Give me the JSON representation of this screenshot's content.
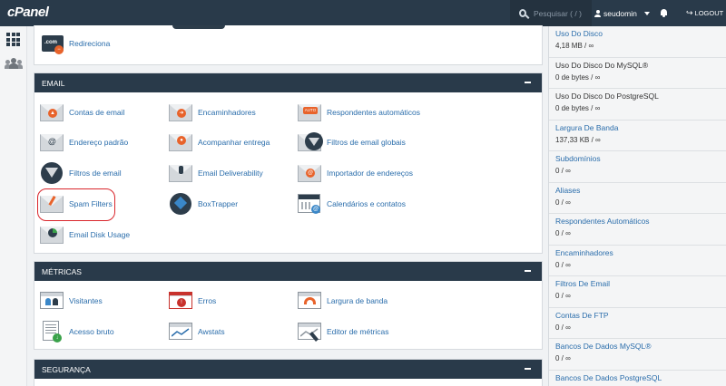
{
  "header": {
    "logo": "cPanel",
    "search_placeholder": "Pesquisar ( / )",
    "username": "seudomin",
    "logout_label": "LOGOUT"
  },
  "top_panel": {
    "items": [
      {
        "label": "Redireciona",
        "icon": "domain-redirect-icon"
      }
    ]
  },
  "email": {
    "title": "EMAIL",
    "items": [
      {
        "label": "Contas de email",
        "icon": "email-accounts-icon"
      },
      {
        "label": "Encaminhadores",
        "icon": "forwarders-icon"
      },
      {
        "label": "Respondentes automáticos",
        "icon": "autoresponders-icon"
      },
      {
        "label": "Endereço padrão",
        "icon": "default-address-icon"
      },
      {
        "label": "Acompanhar entrega",
        "icon": "track-delivery-icon"
      },
      {
        "label": "Filtros de email globais",
        "icon": "global-filters-icon"
      },
      {
        "label": "Filtros de email",
        "icon": "email-filters-icon"
      },
      {
        "label": "Email Deliverability",
        "icon": "deliverability-icon"
      },
      {
        "label": "Importador de endereços",
        "icon": "address-importer-icon"
      },
      {
        "label": "Spam Filters",
        "icon": "spam-filters-icon"
      },
      {
        "label": "BoxTrapper",
        "icon": "boxtrapper-icon"
      },
      {
        "label": "Calendários e contatos",
        "icon": "calendars-icon"
      },
      {
        "label": "Email Disk Usage",
        "icon": "email-disk-usage-icon"
      }
    ]
  },
  "metrics": {
    "title": "MÉTRICAS",
    "items": [
      {
        "label": "Visitantes",
        "icon": "visitors-icon"
      },
      {
        "label": "Erros",
        "icon": "errors-icon"
      },
      {
        "label": "Largura de banda",
        "icon": "bandwidth-icon"
      },
      {
        "label": "Acesso bruto",
        "icon": "raw-access-icon"
      },
      {
        "label": "Awstats",
        "icon": "awstats-icon"
      },
      {
        "label": "Editor de métricas",
        "icon": "metrics-editor-icon"
      }
    ]
  },
  "security": {
    "title": "SEGURANÇA"
  },
  "stats": [
    {
      "label": "Uso Do Disco",
      "value": "4,18 MB / ∞",
      "link": true
    },
    {
      "label": "Uso Do Disco Do MySQL®",
      "value": "0 de bytes / ∞",
      "link": false
    },
    {
      "label": "Uso Do Disco Do PostgreSQL",
      "value": "0 de bytes / ∞",
      "link": false
    },
    {
      "label": "Largura De Banda",
      "value": "137,33 KB / ∞",
      "link": true
    },
    {
      "label": "Subdomínios",
      "value": "0 / ∞",
      "link": true
    },
    {
      "label": "Aliases",
      "value": "0 / ∞",
      "link": true
    },
    {
      "label": "Respondentes Automáticos",
      "value": "0 / ∞",
      "link": true
    },
    {
      "label": "Encaminhadores",
      "value": "0 / ∞",
      "link": true
    },
    {
      "label": "Filtros De Email",
      "value": "0 / ∞",
      "link": true
    },
    {
      "label": "Contas De FTP",
      "value": "0 / ∞",
      "link": true
    },
    {
      "label": "Bancos De Dados MySQL®",
      "value": "0 / ∞",
      "link": true
    },
    {
      "label": "Bancos De Dados PostgreSQL",
      "value": "",
      "link": true
    }
  ],
  "colors": {
    "header_bg": "#293a4a",
    "link": "#2a6dab",
    "highlight": "#d9262c"
  }
}
